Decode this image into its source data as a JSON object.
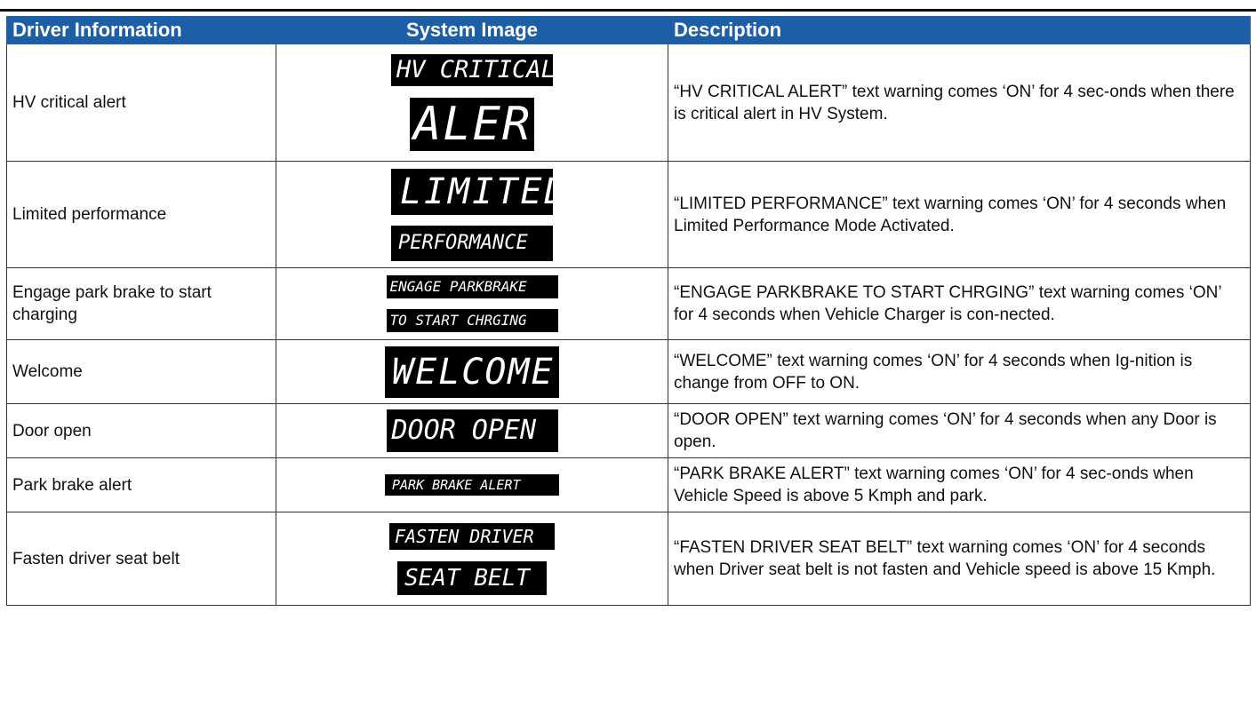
{
  "headers": {
    "col1": "Driver Information",
    "col2": "System Image",
    "col3": "Description"
  },
  "rows": [
    {
      "driver_info": "HV critical alert",
      "display_lines": [
        "HV CRITICAL",
        "ALERT"
      ],
      "description": "“HV CRITICAL ALERT” text warning comes ‘ON’ for 4 sec-onds when there is critical alert in HV System."
    },
    {
      "driver_info": "Limited performance",
      "display_lines": [
        "LIMITED",
        "PERFORMANCE"
      ],
      "description": "“LIMITED PERFORMANCE” text warning comes ‘ON’ for 4 seconds when Limited Performance Mode Activated."
    },
    {
      "driver_info": "Engage park brake to start charging",
      "display_lines": [
        "ENGAGE PARKBRAKE",
        "TO START CHRGING"
      ],
      "description": "“ENGAGE PARKBRAKE TO START CHRGING” text warning comes ‘ON’ for 4 seconds when Vehicle Charger is con-nected."
    },
    {
      "driver_info": "Welcome",
      "display_lines": [
        "WELCOME"
      ],
      "description": "“WELCOME” text warning comes ‘ON’ for 4 seconds when Ig-nition is change from OFF to ON."
    },
    {
      "driver_info": "Door open",
      "display_lines": [
        "DOOR OPEN"
      ],
      "description": "“DOOR OPEN” text warning comes ‘ON’ for 4 seconds when any Door is open."
    },
    {
      "driver_info": "Park brake alert",
      "display_lines": [
        "PARK BRAKE ALERT"
      ],
      "description": "“PARK BRAKE ALERT” text warning comes ‘ON’ for 4 sec-onds when Vehicle Speed is above 5 Kmph and park."
    },
    {
      "driver_info": "Fasten driver seat belt",
      "display_lines": [
        "FASTEN DRIVER",
        "SEAT BELT"
      ],
      "description": "“FASTEN DRIVER SEAT BELT” text warning comes ‘ON’ for 4 seconds when Driver seat belt is not fasten and Vehicle speed is above 15 Kmph."
    }
  ]
}
